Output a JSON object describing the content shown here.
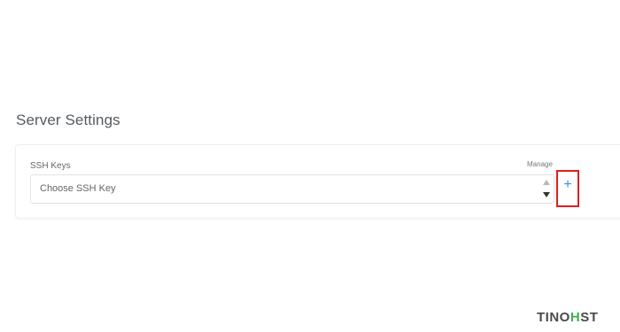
{
  "section": {
    "title": "Server Settings"
  },
  "ssh_keys": {
    "label": "SSH Keys",
    "manage_label": "Manage",
    "select_value": "Choose SSH Key",
    "add_label": "+"
  },
  "logo": {
    "part1": "TINO",
    "accent": "H",
    "part2": "ST",
    "accent_color": "#3db14a"
  }
}
